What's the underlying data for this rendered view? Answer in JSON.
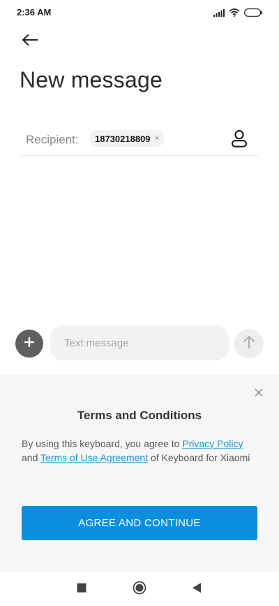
{
  "status_bar": {
    "time": "2:36 AM"
  },
  "header": {
    "title": "New message",
    "back_icon": "arrow-left-icon"
  },
  "recipient": {
    "label": "Recipient:",
    "chips": [
      "18730218809"
    ],
    "chip_close": "×",
    "contact_icon": "person-icon"
  },
  "compose": {
    "placeholder": "Text message",
    "attach_icon": "plus-icon",
    "send_icon": "arrow-up-icon"
  },
  "terms": {
    "title": "Terms and Conditions",
    "body_prefix": "By using this keyboard, you agree to ",
    "privacy_link": "Privacy Policy",
    "body_and": " and ",
    "terms_link": "Terms of Use Agreement",
    "body_suffix": " of Keyboard for Xiaomi",
    "agree_label": "AGREE AND CONTINUE",
    "close_icon": "close-icon"
  },
  "colors": {
    "accent": "#0a8fde",
    "link": "#1a96d8",
    "panel_bg": "#f6f6f6"
  }
}
